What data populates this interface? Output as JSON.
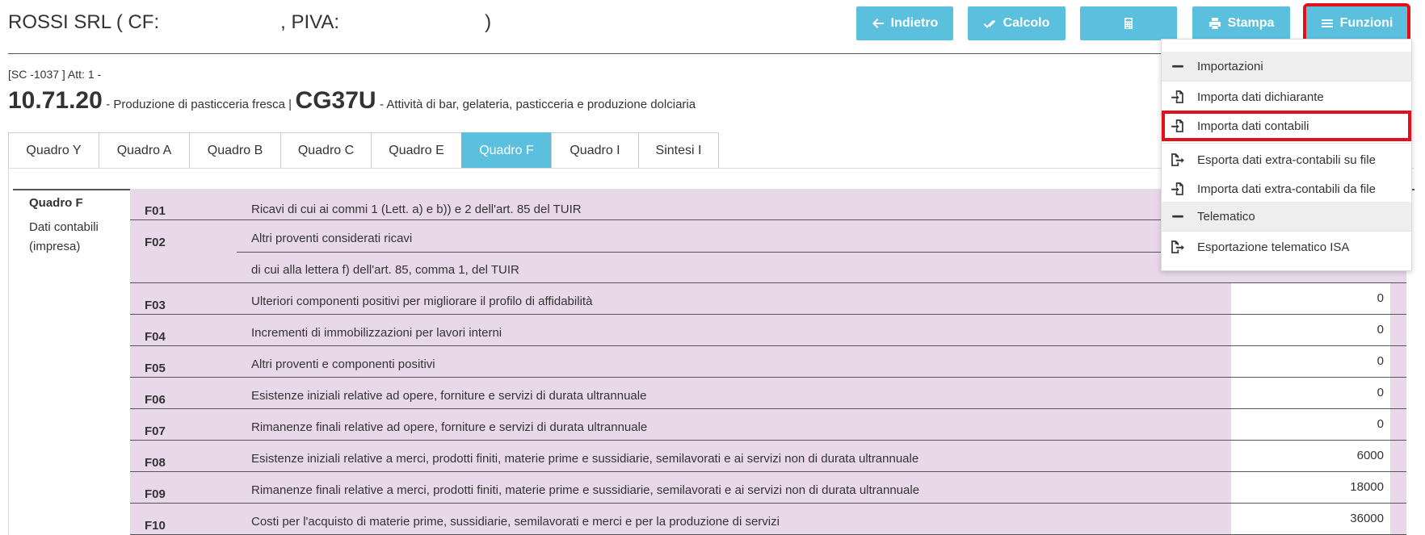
{
  "header": {
    "company": "ROSSI SRL ( CF:",
    "piva_label": ", PIVA:",
    "closing": ")"
  },
  "toolbar": {
    "back_label": "Indietro",
    "calc_label": "Calcolo",
    "print_label": "Stampa",
    "functions_label": "Funzioni"
  },
  "meta": {
    "line": "[SC -1037 ] Att: 1 -"
  },
  "activity": {
    "code1": "10.71.20",
    "desc1": "- Produzione di pasticceria fresca |",
    "code2": "CG37U",
    "desc2": "- Attività di bar, gelateria, pasticceria e produzione dolciaria"
  },
  "tabs": [
    {
      "label": "Quadro Y",
      "active": false
    },
    {
      "label": "Quadro A",
      "active": false
    },
    {
      "label": "Quadro B",
      "active": false
    },
    {
      "label": "Quadro C",
      "active": false
    },
    {
      "label": "Quadro E",
      "active": false
    },
    {
      "label": "Quadro F",
      "active": true
    },
    {
      "label": "Quadro I",
      "active": false
    },
    {
      "label": "Sintesi I",
      "active": false
    }
  ],
  "section": {
    "title": "Quadro F",
    "subtitle_line1": "Dati contabili",
    "subtitle_line2": "(impresa)"
  },
  "rows": [
    {
      "code": "F01",
      "desc": "Ricavi di cui ai commi 1 (Lett. a) e b)) e 2 dell'art. 85 del TUIR",
      "value": ""
    },
    {
      "code": "F02",
      "desc": "Altri proventi considerati ricavi",
      "desc2": "di cui alla lettera f) dell'art. 85, comma 1, del TUIR",
      "value": ""
    },
    {
      "code": "F03",
      "desc": "Ulteriori componenti positivi per migliorare il profilo di affidabilità",
      "value": "0"
    },
    {
      "code": "F04",
      "desc": "Incrementi di immobilizzazioni per lavori interni",
      "value": "0"
    },
    {
      "code": "F05",
      "desc": "Altri proventi e componenti positivi",
      "value": "0"
    },
    {
      "code": "F06",
      "desc": "Esistenze iniziali relative ad opere, forniture e servizi di durata ultrannuale",
      "value": "0"
    },
    {
      "code": "F07",
      "desc": "Rimanenze finali relative ad opere, forniture e servizi di durata ultrannuale",
      "value": "0"
    },
    {
      "code": "F08",
      "desc": "Esistenze iniziali relative a merci, prodotti finiti, materie prime e sussidiarie, semilavorati e ai servizi non di durata ultrannuale",
      "value": "6000"
    },
    {
      "code": "F09",
      "desc": "Rimanenze finali relative a merci, prodotti finiti, materie prime e sussidiarie, semilavorati e ai servizi non di durata ultrannuale",
      "value": "18000"
    },
    {
      "code": "F10",
      "desc": "Costi per l'acquisto di materie prime, sussidiarie, semilavorati e merci e per la produzione di servizi",
      "value": "36000"
    }
  ],
  "dropdown": {
    "items": [
      {
        "label": "Importazioni",
        "icon": "minus-icon",
        "header": true
      },
      {
        "label": "Importa dati dichiarante",
        "icon": "file-import-icon",
        "header": false
      },
      {
        "label": "Importa dati contabili",
        "icon": "file-import-icon",
        "header": false,
        "highlighted": true
      },
      {
        "label": "Esporta dati extra-contabili su file",
        "icon": "file-export-icon",
        "header": false
      },
      {
        "label": "Importa dati extra-contabili da file",
        "icon": "file-import-icon",
        "header": false
      },
      {
        "label": "Telematico",
        "icon": "minus-icon",
        "header": true
      },
      {
        "label": "Esportazione telematico ISA",
        "icon": "file-export-icon",
        "header": false
      }
    ]
  },
  "colors": {
    "accent": "#5bc0de",
    "highlight": "#e3101b",
    "row_bg": "#e8d8ea"
  }
}
